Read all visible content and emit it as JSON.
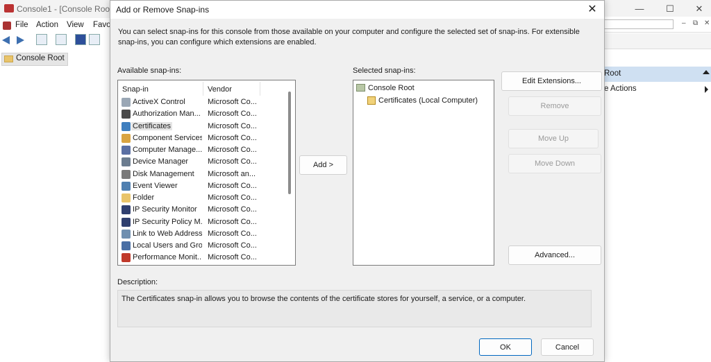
{
  "background_window": {
    "title": "Console1 - [Console Root]",
    "menu": [
      "File",
      "Action",
      "View",
      "Favo"
    ],
    "tree_root": "Console Root",
    "actions_header": "Root",
    "actions_more": "e Actions",
    "window_controls": {
      "minimize": "—",
      "maximize": "☐",
      "close": "✕"
    },
    "inner_controls": {
      "minimize": "–",
      "restore": "⧉",
      "close": "✕"
    }
  },
  "dialog": {
    "title": "Add or Remove Snap-ins",
    "close_label": "✕",
    "intro": "You can select snap-ins for this console from those available on your computer and configure the selected set of snap-ins. For extensible snap-ins, you can configure which extensions are enabled.",
    "available_label": "Available snap-ins:",
    "selected_label": "Selected snap-ins:",
    "columns": {
      "snapin": "Snap-in",
      "vendor": "Vendor"
    },
    "available": [
      {
        "name": "ActiveX Control",
        "vendor": "Microsoft Co...",
        "icon": "activex-icon",
        "color": "#9aa7b5"
      },
      {
        "name": "Authorization Man...",
        "vendor": "Microsoft Co...",
        "icon": "authorization-icon",
        "color": "#4a4a4a"
      },
      {
        "name": "Certificates",
        "vendor": "Microsoft Co...",
        "icon": "certificate-icon",
        "color": "#3f7fbf",
        "selected": true
      },
      {
        "name": "Component Services",
        "vendor": "Microsoft Co...",
        "icon": "component-icon",
        "color": "#d9a441"
      },
      {
        "name": "Computer Manage...",
        "vendor": "Microsoft Co...",
        "icon": "computer-management-icon",
        "color": "#5a6fa3"
      },
      {
        "name": "Device Manager",
        "vendor": "Microsoft Co...",
        "icon": "device-manager-icon",
        "color": "#6b7c8f"
      },
      {
        "name": "Disk Management",
        "vendor": "Microsoft an...",
        "icon": "disk-icon",
        "color": "#7a7a7a"
      },
      {
        "name": "Event Viewer",
        "vendor": "Microsoft Co...",
        "icon": "event-viewer-icon",
        "color": "#4f7fb0"
      },
      {
        "name": "Folder",
        "vendor": "Microsoft Co...",
        "icon": "folder-icon",
        "color": "#e9c46a"
      },
      {
        "name": "IP Security Monitor",
        "vendor": "Microsoft Co...",
        "icon": "ip-security-monitor-icon",
        "color": "#2f3f6f"
      },
      {
        "name": "IP Security Policy M...",
        "vendor": "Microsoft Co...",
        "icon": "ip-security-policy-icon",
        "color": "#2f3f6f"
      },
      {
        "name": "Link to Web Address",
        "vendor": "Microsoft Co...",
        "icon": "web-link-icon",
        "color": "#6f8fb0"
      },
      {
        "name": "Local Users and Gro...",
        "vendor": "Microsoft Co...",
        "icon": "users-icon",
        "color": "#4a6fa5"
      },
      {
        "name": "Performance Monit...",
        "vendor": "Microsoft Co...",
        "icon": "performance-icon",
        "color": "#c0392b"
      }
    ],
    "add_button": "Add >",
    "selected_tree": {
      "root": "Console Root",
      "children": [
        "Certificates (Local Computer)"
      ]
    },
    "buttons": {
      "edit_extensions": "Edit Extensions...",
      "remove": "Remove",
      "move_up": "Move Up",
      "move_down": "Move Down",
      "advanced": "Advanced..."
    },
    "description_label": "Description:",
    "description": "The Certificates snap-in allows you to browse the contents of the certificate stores for yourself, a service, or a computer.",
    "ok": "OK",
    "cancel": "Cancel"
  }
}
